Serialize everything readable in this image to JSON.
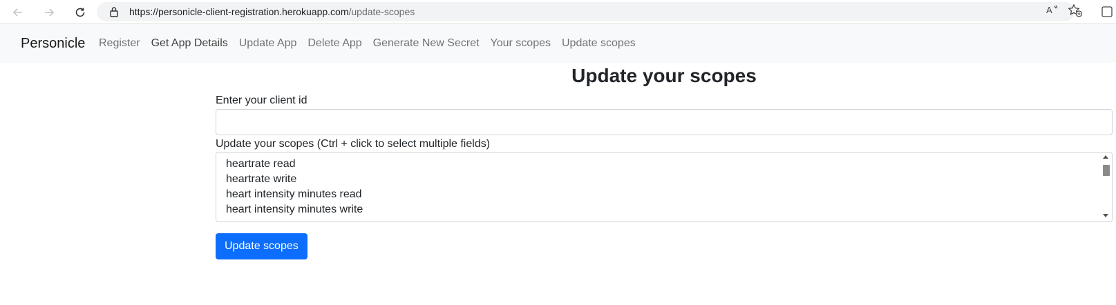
{
  "browser": {
    "url_host": "https://personicle-client-registration.herokuapp.com",
    "url_path": "/update-scopes",
    "icons": [
      "back-arrow-icon",
      "forward-arrow-icon",
      "refresh-icon",
      "lock-icon",
      "read-aloud-icon",
      "add-favorite-icon"
    ]
  },
  "navbar": {
    "brand": "Personicle",
    "links": [
      "Register",
      "Get App Details",
      "Update App",
      "Delete App",
      "Generate New Secret",
      "Your scopes",
      "Update scopes"
    ]
  },
  "form": {
    "title": "Update your scopes",
    "client_id_label": "Enter your client id",
    "client_id_value": "",
    "scopes_label": "Update your scopes (Ctrl + click to select multiple fields)",
    "scope_options": [
      "heartrate read",
      "heartrate write",
      "heart intensity minutes read",
      "heart intensity minutes write"
    ],
    "submit_label": "Update scopes"
  },
  "colors": {
    "primary": "#0d6efd",
    "navbar_bg": "#f8f9fa"
  }
}
